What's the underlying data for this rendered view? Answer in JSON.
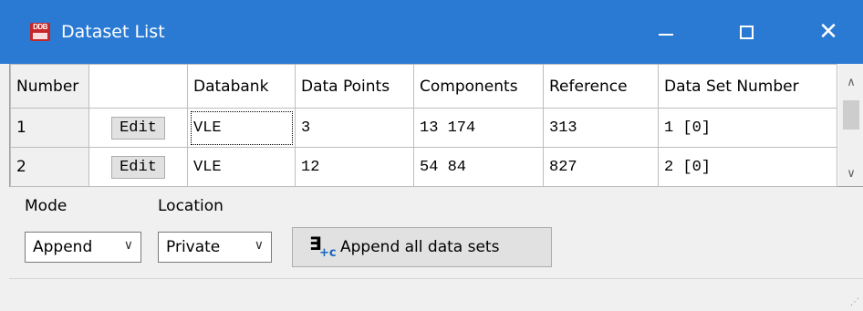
{
  "window": {
    "icon_text": "DDB",
    "title": "Dataset List",
    "minimize_glyph": "—",
    "close_glyph": "✕"
  },
  "table": {
    "headers": [
      "Number",
      "",
      "Databank",
      "Data Points",
      "Components",
      "Reference",
      "Data Set Number"
    ],
    "rows": [
      {
        "number": "1",
        "edit": "Edit",
        "databank": "VLE",
        "data_points": "3",
        "components": "13 174",
        "reference": "313",
        "data_set_number": "1 [0]"
      },
      {
        "number": "2",
        "edit": "Edit",
        "databank": "VLE",
        "data_points": "12",
        "components": "54 84",
        "reference": "827",
        "data_set_number": "2 [0]"
      }
    ]
  },
  "scrollbar": {
    "up_glyph": "∧",
    "down_glyph": "∨"
  },
  "controls": {
    "mode_label": "Mode",
    "mode_value": "Append",
    "location_label": "Location",
    "location_value": "Private",
    "append_button_label": "Append all data sets",
    "chevron_glyph": "∨"
  },
  "icons": {
    "app": "ddb-app-icon",
    "append": "exists-append-icon"
  },
  "colors": {
    "titlebar": "#2a7ad3",
    "app_icon": "#c62828",
    "append_icon_accent": "#1565c0"
  }
}
